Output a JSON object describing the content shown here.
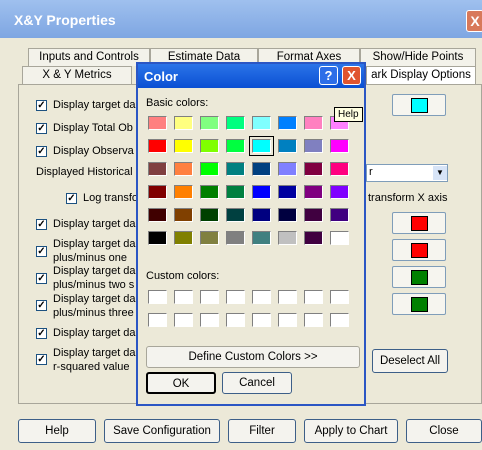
{
  "window": {
    "title": "X&Y Properties",
    "close": "X"
  },
  "tabs_row1": [
    "Inputs and Controls",
    "Estimate Data",
    "Format Axes",
    "Show/Hide Points"
  ],
  "tabs_row2": [
    "X & Y Metrics",
    "",
    "",
    "ark Display Options"
  ],
  "panel": {
    "items": [
      {
        "label": "Display target da"
      },
      {
        "label": "Display Total Ob"
      },
      {
        "label": "Display Observa"
      }
    ],
    "historical_label": "Displayed Historical",
    "dropdown_value": "r",
    "log_label": "Log transfo",
    "log_x_label": "transform X axis",
    "items2": [
      {
        "label": "Display target da"
      },
      {
        "label": "Display target da",
        "label2": "plus/minus one"
      },
      {
        "label": "Display target da",
        "label2": "plus/minus two s"
      },
      {
        "label": "Display target da",
        "label2": "plus/minus three"
      },
      {
        "label": "Display target da"
      },
      {
        "label": "Display target da",
        "label2": "r-squared value"
      }
    ],
    "deselect_all": "Deselect All"
  },
  "swatches": [
    "#00ffff",
    "#ff0000",
    "#ff0000",
    "#008000",
    "#008000"
  ],
  "bottom_buttons": [
    "Help",
    "Save Configuration",
    "Filter",
    "Apply to Chart",
    "Close"
  ],
  "color_dialog": {
    "title": "Color",
    "help_btn": "?",
    "close_btn": "X",
    "tooltip": "Help",
    "basic_label": "Basic colors:",
    "custom_label": "Custom colors:",
    "define_btn": "Define Custom Colors >>",
    "ok_btn": "OK",
    "cancel_btn": "Cancel",
    "selected_index": 12,
    "basic_colors": [
      "#ff8080",
      "#ffff80",
      "#80ff80",
      "#00ff80",
      "#80ffff",
      "#0080ff",
      "#ff80c0",
      "#ff80ff",
      "#ff0000",
      "#ffff00",
      "#80ff00",
      "#00ff40",
      "#00ffff",
      "#0080c0",
      "#8080c0",
      "#ff00ff",
      "#804040",
      "#ff8040",
      "#00ff00",
      "#008080",
      "#004080",
      "#8080ff",
      "#800040",
      "#ff0080",
      "#800000",
      "#ff8000",
      "#008000",
      "#008040",
      "#0000ff",
      "#0000a0",
      "#800080",
      "#8000ff",
      "#400000",
      "#804000",
      "#004000",
      "#004040",
      "#000080",
      "#000040",
      "#400040",
      "#400080",
      "#000000",
      "#808000",
      "#808040",
      "#808080",
      "#408080",
      "#c0c0c0",
      "#400040",
      "#ffffff"
    ]
  }
}
